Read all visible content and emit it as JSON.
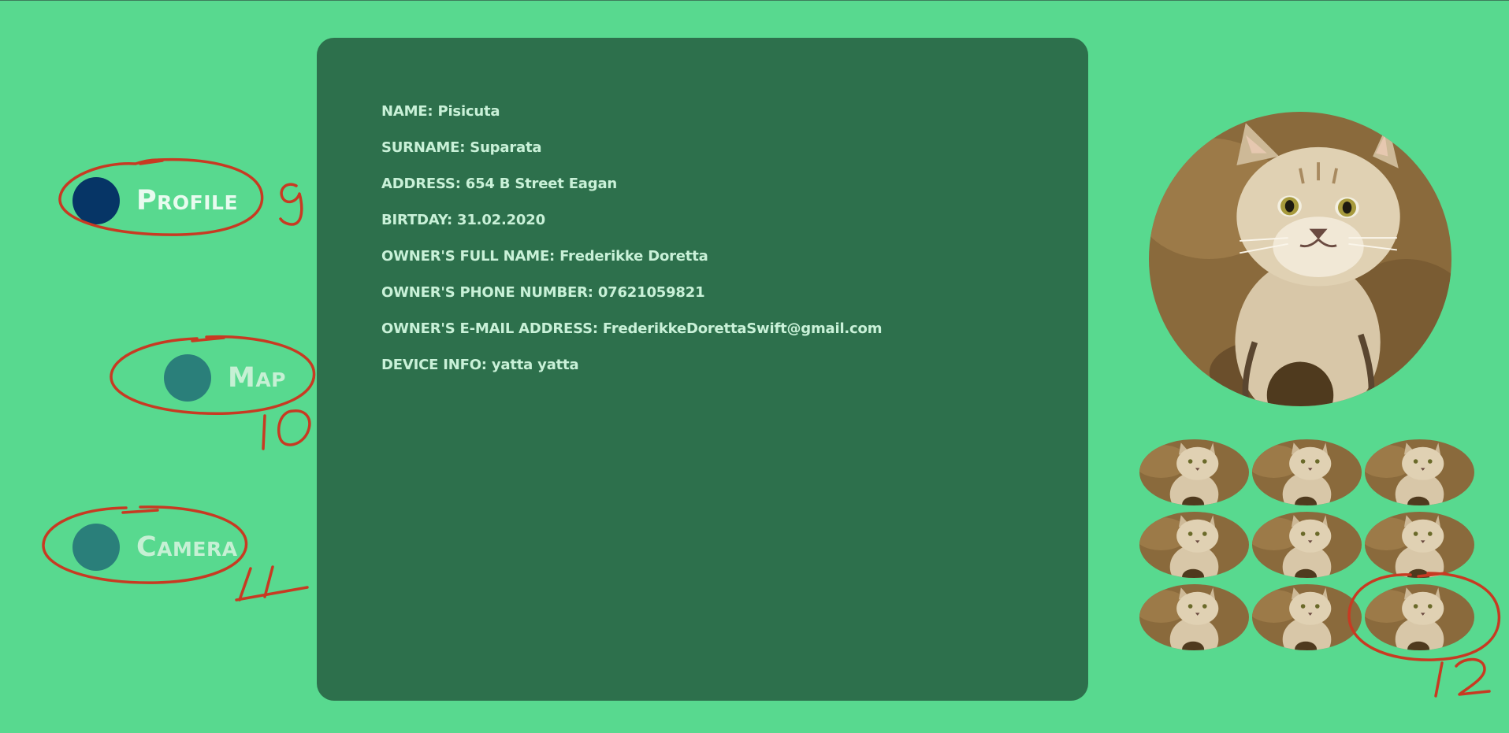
{
  "nav": {
    "items": [
      {
        "label": "Profile",
        "icon": "profile-dot-icon",
        "color": "#063566",
        "active": true
      },
      {
        "label": "Map",
        "icon": "map-dot-icon",
        "color": "#2a7f7a",
        "active": false
      },
      {
        "label": "Camera",
        "icon": "camera-dot-icon",
        "color": "#2a7f7a",
        "active": false
      }
    ]
  },
  "profile": {
    "fields": [
      "NAME: Pisicuta",
      "SURNAME: Suparata",
      "ADDRESS: 654 B Street Eagan",
      "BIRTDAY: 31.02.2020",
      "OWNER'S FULL NAME: Frederikke Doretta",
      "OWNER'S PHONE NUMBER: 07621059821",
      "OWNER'S E-MAIL ADDRESS: FrederikkeDorettaSwift@gmail.com",
      "DEVICE INFO: yatta yatta"
    ]
  },
  "gallery": {
    "main_photo": "sand-cat-photo",
    "thumbnail_count": 9
  },
  "annotations": {
    "labels": [
      "9",
      "10",
      "11",
      "12"
    ],
    "color": "#c83a22"
  },
  "colors": {
    "background": "#58d98f",
    "panel": "#2d704c",
    "panel_text": "#c9f1d8"
  }
}
